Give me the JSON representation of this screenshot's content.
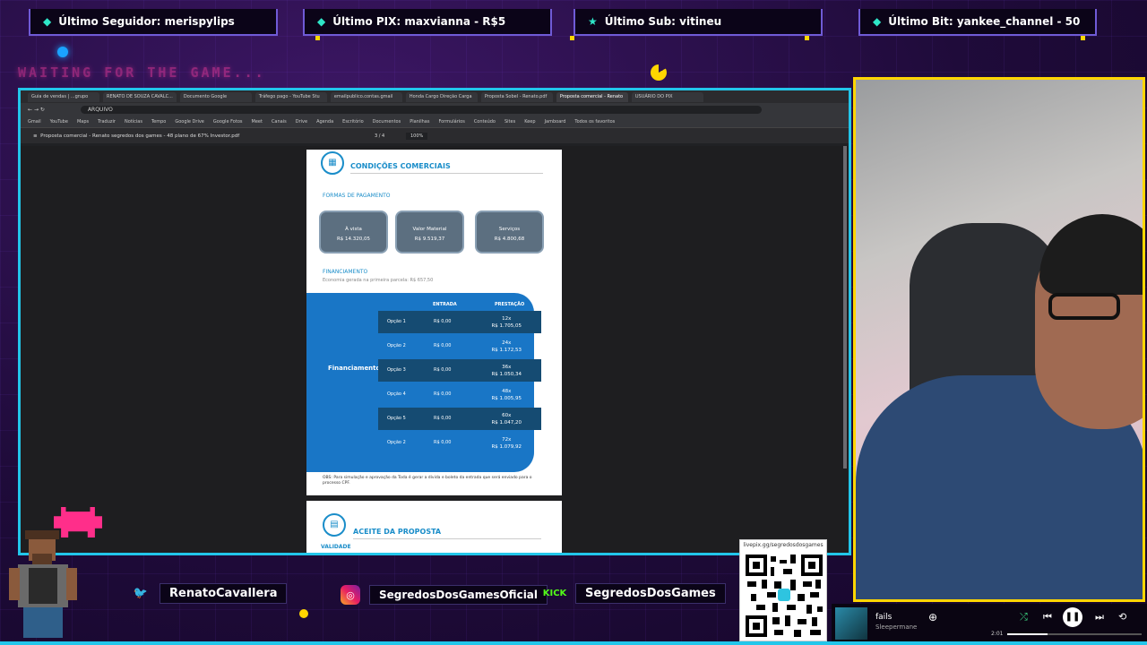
{
  "top_stats": [
    {
      "label": "Último Seguidor: merispylips",
      "icon": "heart-icon"
    },
    {
      "label": "Último PIX: maxvianna - R$5",
      "icon": "pix-icon"
    },
    {
      "label": "Último Sub: vitineu",
      "icon": "star-icon"
    },
    {
      "label": "Último Bit: yankee_channel - 50",
      "icon": "diamond-icon"
    }
  ],
  "waiting_text": "WAITING FOR THE GAME...",
  "browser": {
    "tabs": [
      "Guia de vendas | ...grupo",
      "RENATO DE SOUZA CAVALC...",
      "Documento Google",
      "Tráfego pago - YouTube Stu",
      "emailpublico.contas.gmail",
      "Honda Cargo Direção Carga",
      "Proposta Sobel - Renato.pdf",
      "Proposta comercial - Renato",
      "USUÁRIO DO PIX"
    ],
    "url": "ARQUIVO",
    "bookmarks": [
      "Gmail",
      "YouTube",
      "Maps",
      "Traduzir",
      "Notícias",
      "Tempo",
      "Google Drive",
      "Google Fotos",
      "Meet",
      "Canais",
      "Drive",
      "Agenda",
      "Escritório",
      "Documentos",
      "Planilhas",
      "Formulários",
      "Conteúdo",
      "Sites",
      "Keep",
      "Jamboard",
      "Todos os favoritos"
    ],
    "pdf_title": "Proposta comercial - Renato segredos dos games - 48 plano de 67% Investor.pdf",
    "page_number": "3",
    "page_total": "/ 4",
    "zoom": "100%"
  },
  "proposal": {
    "section_title": "CONDIÇÕES COMERCIAIS",
    "payment_heading": "FORMAS DE PAGAMENTO",
    "pay_options": [
      {
        "label": "À vista",
        "value": "R$ 14.320,05"
      },
      {
        "label": "Valor Material",
        "value": "R$ 9.519,37"
      },
      {
        "label": "Serviços",
        "value": "R$ 4.800,68"
      }
    ],
    "financing_heading": "FINANCIAMENTO",
    "financing_note": "Economia gerada na primeira parcela: R$ 657,50",
    "financing_label": "Financiamento BV",
    "col_entrada": "ENTRADA",
    "col_prestacao": "PRESTAÇÃO",
    "rows": [
      {
        "option": "Opção 1",
        "entrada": "R$ 0,00",
        "term": "12x",
        "installment": "R$ 1.705,05"
      },
      {
        "option": "Opção 2",
        "entrada": "R$ 0,00",
        "term": "24x",
        "installment": "R$ 1.172,53"
      },
      {
        "option": "Opção 3",
        "entrada": "R$ 0,00",
        "term": "36x",
        "installment": "R$ 1.050,34"
      },
      {
        "option": "Opção 4",
        "entrada": "R$ 0,00",
        "term": "48x",
        "installment": "R$ 1.005,95"
      },
      {
        "option": "Opção 5",
        "entrada": "R$ 0,00",
        "term": "60x",
        "installment": "R$ 1.047,20"
      },
      {
        "option": "Opção 2",
        "entrada": "R$ 0,00",
        "term": "72x",
        "installment": "R$ 1.079,92"
      }
    ],
    "footnote": "OBS: Para simulação e aprovação da Toda é gerar a dívida e boleto da entrada que será enviado para o processo CPF.",
    "accept_title": "ACEITE DA PROPOSTA",
    "validity": "VALIDADE"
  },
  "socials": [
    {
      "name": "RenatoCavallera",
      "icon": "twitter-icon"
    },
    {
      "name": "SegredosDosGamesOficial",
      "icon": "instagram-icon"
    },
    {
      "name": "SegredosDosGames",
      "icon": "kick-icon",
      "icon_text": "KICK"
    }
  ],
  "qr": {
    "label": "livepix.gg/segredosdosgames"
  },
  "player": {
    "title": "fails",
    "artist": "Sleepermane",
    "time": "2:01"
  },
  "colors": {
    "accent": "#22c6ea",
    "webcam_border": "#ffd600",
    "pdf_blue": "#1976c6"
  }
}
